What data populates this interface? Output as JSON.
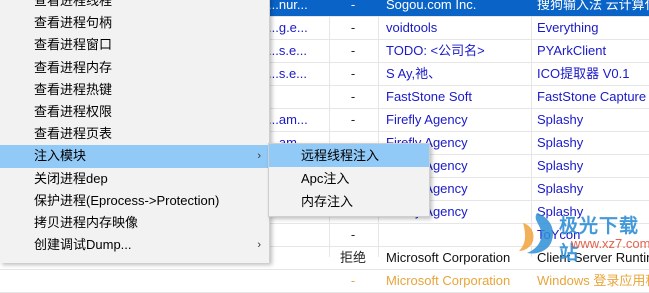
{
  "rows": [
    {
      "path": "...nur...",
      "sig": "-",
      "company": "Sogou.com Inc.",
      "desc": "搜狗输入法 云计算代",
      "style": "selected"
    },
    {
      "path": "...g.e...",
      "sig": "-",
      "company": "voidtools",
      "desc": "Everything",
      "style": ""
    },
    {
      "path": "...s.e...",
      "sig": "-",
      "company": "TODO: <公司名>",
      "desc": "PYArkClient",
      "style": ""
    },
    {
      "path": "...s.e...",
      "sig": "-",
      "company": " S Ay,祂、",
      "desc": "ICO提取器 V0.1",
      "style": ""
    },
    {
      "path": "",
      "sig": "-",
      "company": "FastStone Soft",
      "desc": "FastStone Capture",
      "style": ""
    },
    {
      "path": "...am...",
      "sig": "-",
      "company": "Firefly Agency",
      "desc": "Splashy",
      "style": ""
    },
    {
      "path": "...am...",
      "sig": "-",
      "company": "Firefly Agency",
      "desc": "Splashy",
      "style": ""
    },
    {
      "path": "",
      "sig": "-",
      "company": "Firefly Agency",
      "desc": "Splashy",
      "style": ""
    },
    {
      "path": "",
      "sig": "-",
      "company": "Firefly Agency",
      "desc": "Splashy",
      "style": ""
    },
    {
      "path": "",
      "sig": "-",
      "company": "Firefly Agency",
      "desc": "Splashy",
      "style": ""
    },
    {
      "path": "",
      "sig": "-",
      "company": "",
      "desc": "ToYcon",
      "style": ""
    },
    {
      "path": "",
      "sig": "拒绝",
      "company": "Microsoft Corporation",
      "desc": "Client Server Runtim",
      "style": "black"
    },
    {
      "path": "",
      "sig": "-",
      "company": "Microsoft Corporation",
      "desc": "Windows 登录应用程",
      "style": "orange"
    }
  ],
  "menu": {
    "items": [
      {
        "label": "查看进程线程",
        "submenu": false,
        "highlighted": false
      },
      {
        "label": "查看进程句柄",
        "submenu": false,
        "highlighted": false
      },
      {
        "label": "查看进程窗口",
        "submenu": false,
        "highlighted": false
      },
      {
        "label": "查看进程内存",
        "submenu": false,
        "highlighted": false
      },
      {
        "label": "查看进程热键",
        "submenu": false,
        "highlighted": false
      },
      {
        "label": "查看进程权限",
        "submenu": false,
        "highlighted": false
      },
      {
        "label": "查看进程页表",
        "submenu": false,
        "highlighted": false
      },
      {
        "label": "注入模块",
        "submenu": true,
        "highlighted": true
      },
      {
        "label": "关闭进程dep",
        "submenu": false,
        "highlighted": false
      },
      {
        "label": "保护进程(Eprocess->Protection)",
        "submenu": false,
        "highlighted": false
      },
      {
        "label": "拷贝进程内存映像",
        "submenu": false,
        "highlighted": false
      },
      {
        "label": "创建调试Dump...",
        "submenu": true,
        "highlighted": false
      }
    ],
    "arrow_glyph": "›"
  },
  "submenu": {
    "items": [
      {
        "label": "远程线程注入",
        "highlighted": true
      },
      {
        "label": "Apc注入",
        "highlighted": false
      },
      {
        "label": "内存注入",
        "highlighted": false
      }
    ]
  },
  "watermark": {
    "title": "极光下载站",
    "url": "www.xz7.com"
  },
  "colors": {
    "selection": "#0a64c8",
    "menu_highlight": "#91c9f7",
    "link_blue": "#1a1ac8",
    "system_orange": "#e8a53a"
  }
}
